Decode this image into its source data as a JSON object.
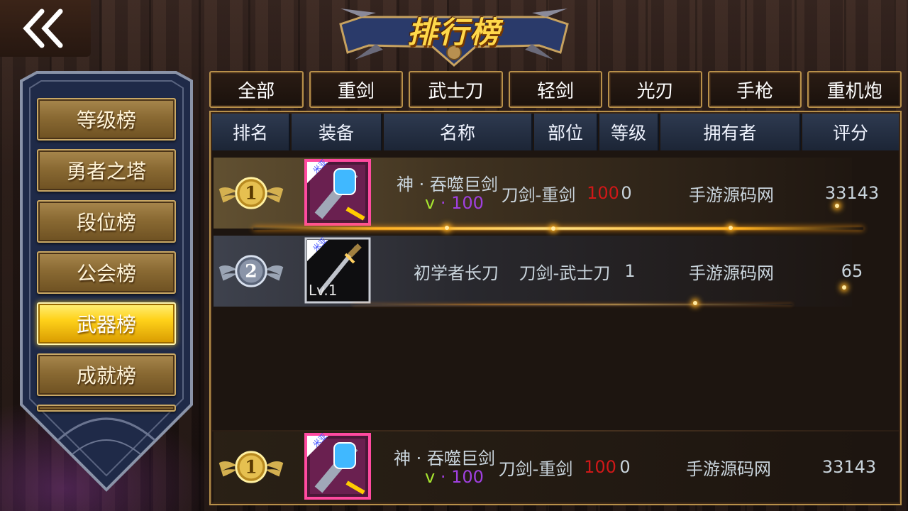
{
  "title": "排行榜",
  "back_icon": "double-chevron-left-icon",
  "side_menu": [
    {
      "label": "等级榜",
      "active": false
    },
    {
      "label": "勇者之塔",
      "active": false
    },
    {
      "label": "段位榜",
      "active": false
    },
    {
      "label": "公会榜",
      "active": false
    },
    {
      "label": "武器榜",
      "active": true
    },
    {
      "label": "成就榜",
      "active": false
    }
  ],
  "tabs": [
    "全部",
    "重剑",
    "武士刀",
    "轻剑",
    "光刃",
    "手枪",
    "重机炮"
  ],
  "columns": [
    "排名",
    "装备",
    "名称",
    "部位",
    "等级",
    "拥有者",
    "评分"
  ],
  "rows": [
    {
      "rank": "1",
      "equip_tag": "米亚",
      "equip_icon": "blue-flask-greatsword-icon",
      "name": "神 · 吞噬巨剑",
      "name_suffix": "v · 100",
      "v_letter": "v",
      "v_level": "· 100",
      "slot": "刀剑-重剑",
      "level_red": "100",
      "level": "0",
      "owner": "手游源码网",
      "score": "33143"
    },
    {
      "rank": "2",
      "equip_tag": "米亚",
      "equip_icon": "katana-icon",
      "equip_level": "Lv.1",
      "name": "初学者长刀",
      "slot": "刀剑-武士刀",
      "level": "1",
      "owner": "手游源码网",
      "score": "65"
    }
  ],
  "my_row": {
    "rank": "1",
    "equip_tag": "米亚",
    "name": "神 · 吞噬巨剑",
    "v_letter": "v",
    "v_level": "· 100",
    "slot": "刀剑-重剑",
    "level_red": "100",
    "level": "0",
    "owner": "手游源码网",
    "score": "33143"
  },
  "colors": {
    "gold": "#ffd21a",
    "border": "#b8904a",
    "header_blue": "#2e3a50",
    "text": "#c9d4dc",
    "red": "#d01818",
    "purple": "#a040e0",
    "green": "#a8e830"
  }
}
